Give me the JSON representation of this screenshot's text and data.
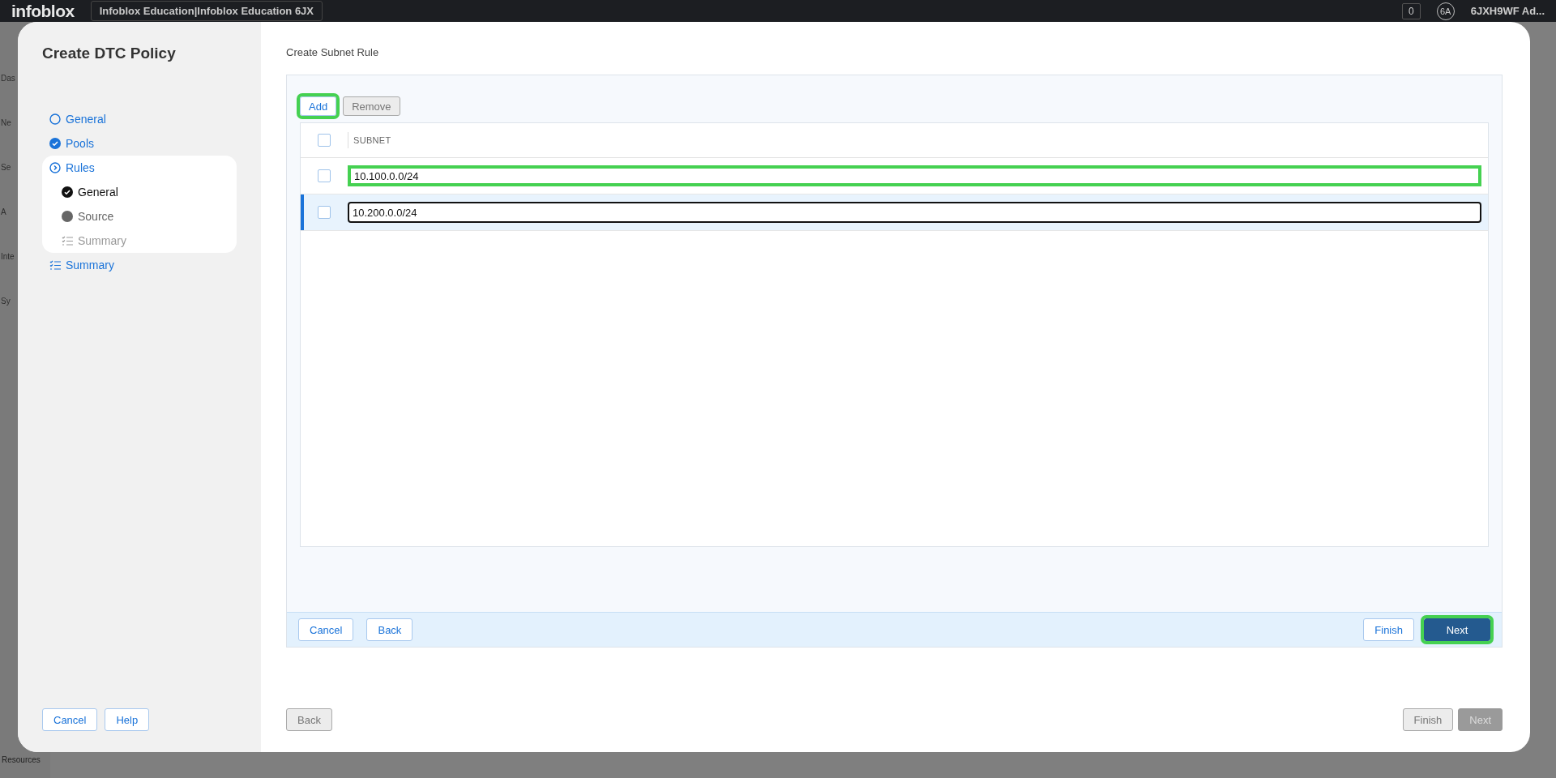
{
  "app_bar": {
    "logo": "infoblox",
    "account": "Infoblox Education|Infoblox Education 6JX",
    "count": "0",
    "avatar": "6A",
    "user": "6JXH9WF Ad..."
  },
  "nav_fragments": [
    "Das",
    "Ne",
    "Se",
    "A",
    "Inte",
    "Sy"
  ],
  "nav_footer": "Resources",
  "dialog": {
    "title": "Create DTC Policy",
    "steps": [
      {
        "label": "General",
        "kind": "todo"
      },
      {
        "label": "Pools",
        "kind": "done"
      },
      {
        "label": "Rules",
        "kind": "current",
        "children": [
          {
            "label": "General",
            "kind": "done"
          },
          {
            "label": "Source",
            "kind": "current"
          },
          {
            "label": "Summary",
            "kind": "summary"
          }
        ]
      },
      {
        "label": "Summary",
        "kind": "summary"
      }
    ],
    "side_buttons": [
      {
        "label": "Cancel"
      },
      {
        "label": "Help"
      }
    ],
    "content_title": "Create Subnet Rule",
    "toolbar": [
      {
        "label": "Add",
        "disabled": false,
        "highlighted": true
      },
      {
        "label": "Remove",
        "disabled": true,
        "highlighted": false
      }
    ],
    "table": {
      "header_checked": false,
      "columns": [
        "SUBNET"
      ],
      "rows": [
        {
          "checked": false,
          "selected": false,
          "value": "10.100.0.0/24",
          "focused": false,
          "highlighted": true
        },
        {
          "checked": false,
          "selected": true,
          "value": "10.200.0.0/24",
          "focused": true,
          "highlighted": false
        }
      ]
    },
    "panel_buttons_left": [
      {
        "label": "Cancel",
        "kind": "secondary",
        "highlighted": false
      },
      {
        "label": "Back",
        "kind": "secondary",
        "highlighted": false
      }
    ],
    "panel_buttons_right": [
      {
        "label": "Finish",
        "kind": "secondary",
        "highlighted": false
      },
      {
        "label": "Next",
        "kind": "primary",
        "highlighted": true
      }
    ],
    "nav_buttons_left": [
      {
        "label": "Back",
        "disabled": true,
        "kind": "secondary"
      }
    ],
    "nav_buttons_right": [
      {
        "label": "Finish",
        "disabled": true,
        "kind": "secondary"
      },
      {
        "label": "Next",
        "disabled": true,
        "kind": "primary"
      }
    ]
  }
}
